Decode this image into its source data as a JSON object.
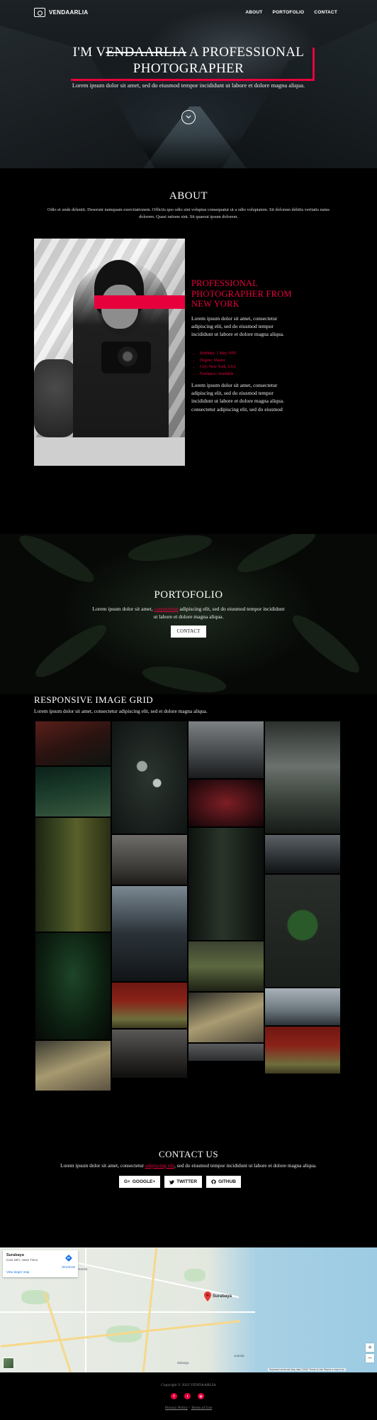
{
  "nav": {
    "brand": "VENDAARLIA",
    "links": [
      "ABOUT",
      "PORTOFOLIO",
      "CONTACT"
    ]
  },
  "hero": {
    "title_pre": "I'M V",
    "title_strike": "ENDAARLIA",
    "title_post": " A PROFESSIONAL PHOTOGRAPHER",
    "subtitle": "Lorem ipsum dolor sit amet, sed do eiusmod tempor incididunt ut labore et dolore magna aliqua.",
    "scroll_icon": "chevron-down-icon"
  },
  "about": {
    "title": "ABOUT",
    "description": "Odio et unde deleniti. Deserunt numquam exercitationem. Officiis quo odio sint voluptas consequatur ut a odio voluptatem. Sit dolorum debitis veritatis natus dolorem. Quasi ratione sint. Sit quaerat ipsum dolorem.",
    "heading": "PROFESSIONAL PHOTOGRAPHER FROM NEW YORK",
    "paragraph1": "Lorem ipsum dolor sit amet, consectetur adipiscing elit, sed do eiusmod tempor incididunt ut labore et dolore magna aliqua.",
    "list": [
      "Birthday: 1 May 1995",
      "Degree: Master",
      "City: New York, USA",
      "Freelance: Available"
    ],
    "paragraph2": "Lorem ipsum dolor sit amet, consectetur adipiscing elit, sed do eiusmod tempor incididunt ut labore et dolore magna aliqua. consectetur adipiscing elit, sed do eiusmod"
  },
  "portfolio": {
    "title": "PORTOFOLIO",
    "desc_pre": "Lorem ipsum dolor sit amet, ",
    "desc_link": "consectetur",
    "desc_post": " adipiscing elit, sed do eiusmod tempor incididunt ut labore et dolore magna aliqua.",
    "button": "CONTACT"
  },
  "grid": {
    "title": "RESPONSIVE IMAGE GRID",
    "description": "Lorem ipsum dolor sit amet, consectetur adipiscing elit, sed et dolore magna aliqua."
  },
  "contact": {
    "title": "CONTACT US",
    "desc_pre": "Lorem ipsum dolor sit amet, consectetur ",
    "desc_link": "adipiscing elit",
    "desc_post": ", sed do eiusmod tempor incididunt ut labore et dolore magna aliqua.",
    "buttons": [
      {
        "label": "GOOGLE+",
        "icon": "google-plus-icon"
      },
      {
        "label": "TWITTER",
        "icon": "twitter-icon"
      },
      {
        "label": "GITHUB",
        "icon": "github-icon"
      }
    ]
  },
  "map": {
    "place": "Surabaya",
    "place_sub": "Kota SBY, Jawa Timur",
    "larger_map": "View larger map",
    "directions": "Directions",
    "labels": [
      "Surabaya",
      "Sidoarjo",
      "Gresik",
      "Juanda"
    ],
    "attribution": "Keyboard shortcuts  Map data ©2022  Terms of Use  Report a map error"
  },
  "footer": {
    "copyright": "Copyright © 2022 VENDAARLIA",
    "links": [
      "Privacy Policy",
      "Terms of Use"
    ],
    "socials": [
      "facebook-icon",
      "twitter-icon",
      "instagram-icon"
    ]
  },
  "colors": {
    "accent": "#e8003d",
    "background": "#000000"
  }
}
